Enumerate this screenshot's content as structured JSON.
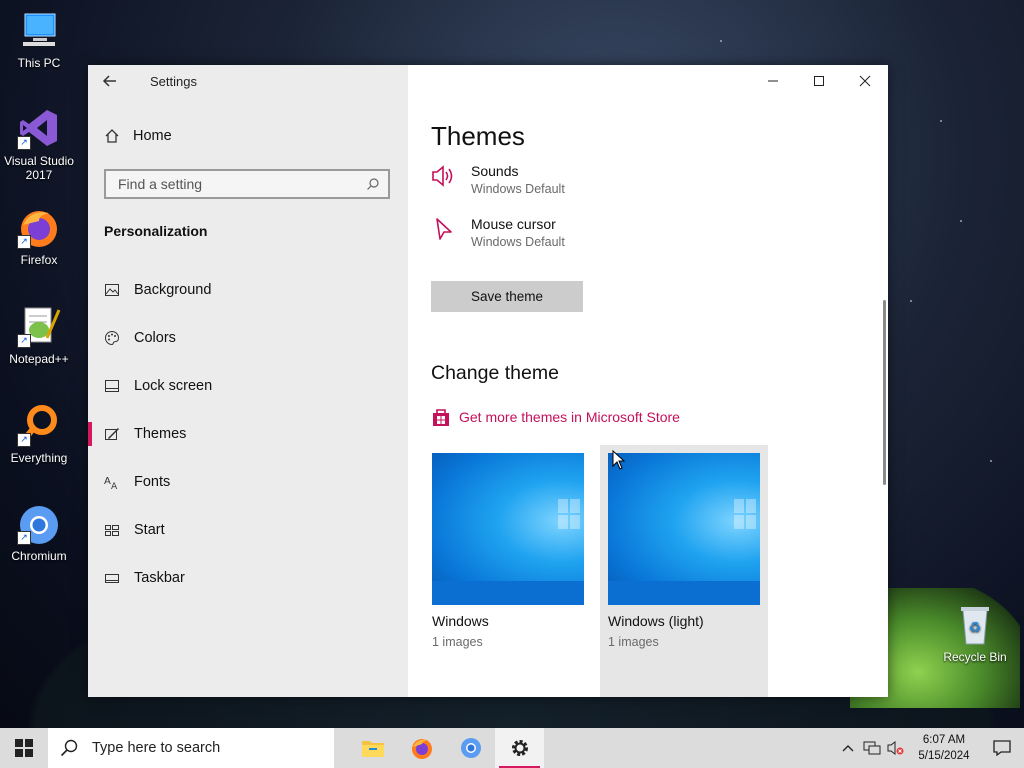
{
  "desktop": {
    "icons": [
      {
        "label": "This PC"
      },
      {
        "label": "Visual Studio 2017"
      },
      {
        "label": "Firefox"
      },
      {
        "label": "Notepad++"
      },
      {
        "label": "Everything"
      },
      {
        "label": "Chromium"
      },
      {
        "label": "Recycle Bin"
      }
    ]
  },
  "window": {
    "title": "Settings",
    "sidebar": {
      "home_label": "Home",
      "search_placeholder": "Find a setting",
      "section_title": "Personalization",
      "items": [
        {
          "label": "Background",
          "icon": "image-icon"
        },
        {
          "label": "Colors",
          "icon": "palette-icon"
        },
        {
          "label": "Lock screen",
          "icon": "lock-screen-icon"
        },
        {
          "label": "Themes",
          "icon": "brush-icon",
          "active": true
        },
        {
          "label": "Fonts",
          "icon": "font-icon"
        },
        {
          "label": "Start",
          "icon": "start-grid-icon"
        },
        {
          "label": "Taskbar",
          "icon": "taskbar-icon"
        }
      ]
    },
    "main": {
      "heading": "Themes",
      "sounds": {
        "title": "Sounds",
        "value": "Windows Default"
      },
      "mouse_cursor": {
        "title": "Mouse cursor",
        "value": "Windows Default"
      },
      "save_button": "Save theme",
      "change_heading": "Change theme",
      "store_link": "Get more themes in Microsoft Store",
      "themes": [
        {
          "name": "Windows",
          "count": "1 images"
        },
        {
          "name": "Windows (light)",
          "count": "1 images"
        }
      ]
    },
    "accent_color": "#d6185e"
  },
  "taskbar": {
    "search_placeholder": "Type here to search",
    "clock_time": "6:07 AM",
    "clock_date": "5/15/2024"
  }
}
